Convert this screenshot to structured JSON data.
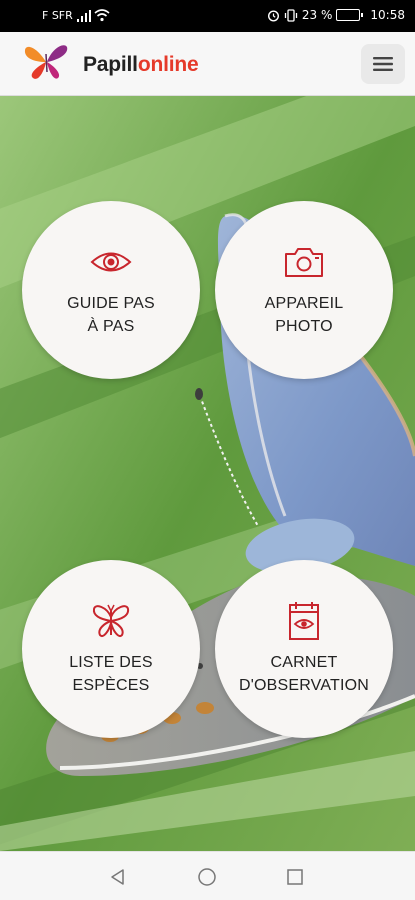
{
  "status_bar": {
    "carrier": "F SFR",
    "battery_percent": "23 %",
    "time": "10:58",
    "icons": [
      "signal-icon",
      "wifi-icon",
      "alarm-icon",
      "vibrate-icon",
      "battery-icon"
    ]
  },
  "app_bar": {
    "brand_part1": "Papill",
    "brand_part2": "online",
    "menu_icon": "hamburger-menu-icon"
  },
  "tiles": [
    {
      "line1": "GUIDE PAS",
      "line2": "À PAS",
      "icon": "eye-icon"
    },
    {
      "line1": "APPAREIL",
      "line2": "PHOTO",
      "icon": "camera-icon"
    },
    {
      "line1": "LISTE DES",
      "line2": "ESPÈCES",
      "icon": "butterfly-icon"
    },
    {
      "line1": "CARNET",
      "line2": "D'OBSERVATION",
      "icon": "notebook-eye-icon"
    }
  ],
  "nav_bar": {
    "buttons": [
      "back-icon",
      "home-icon",
      "recent-apps-icon"
    ]
  },
  "colors": {
    "accent": "#c8262d",
    "brand_red": "#e53a2a",
    "tile_bg": "#f8f6f4"
  }
}
